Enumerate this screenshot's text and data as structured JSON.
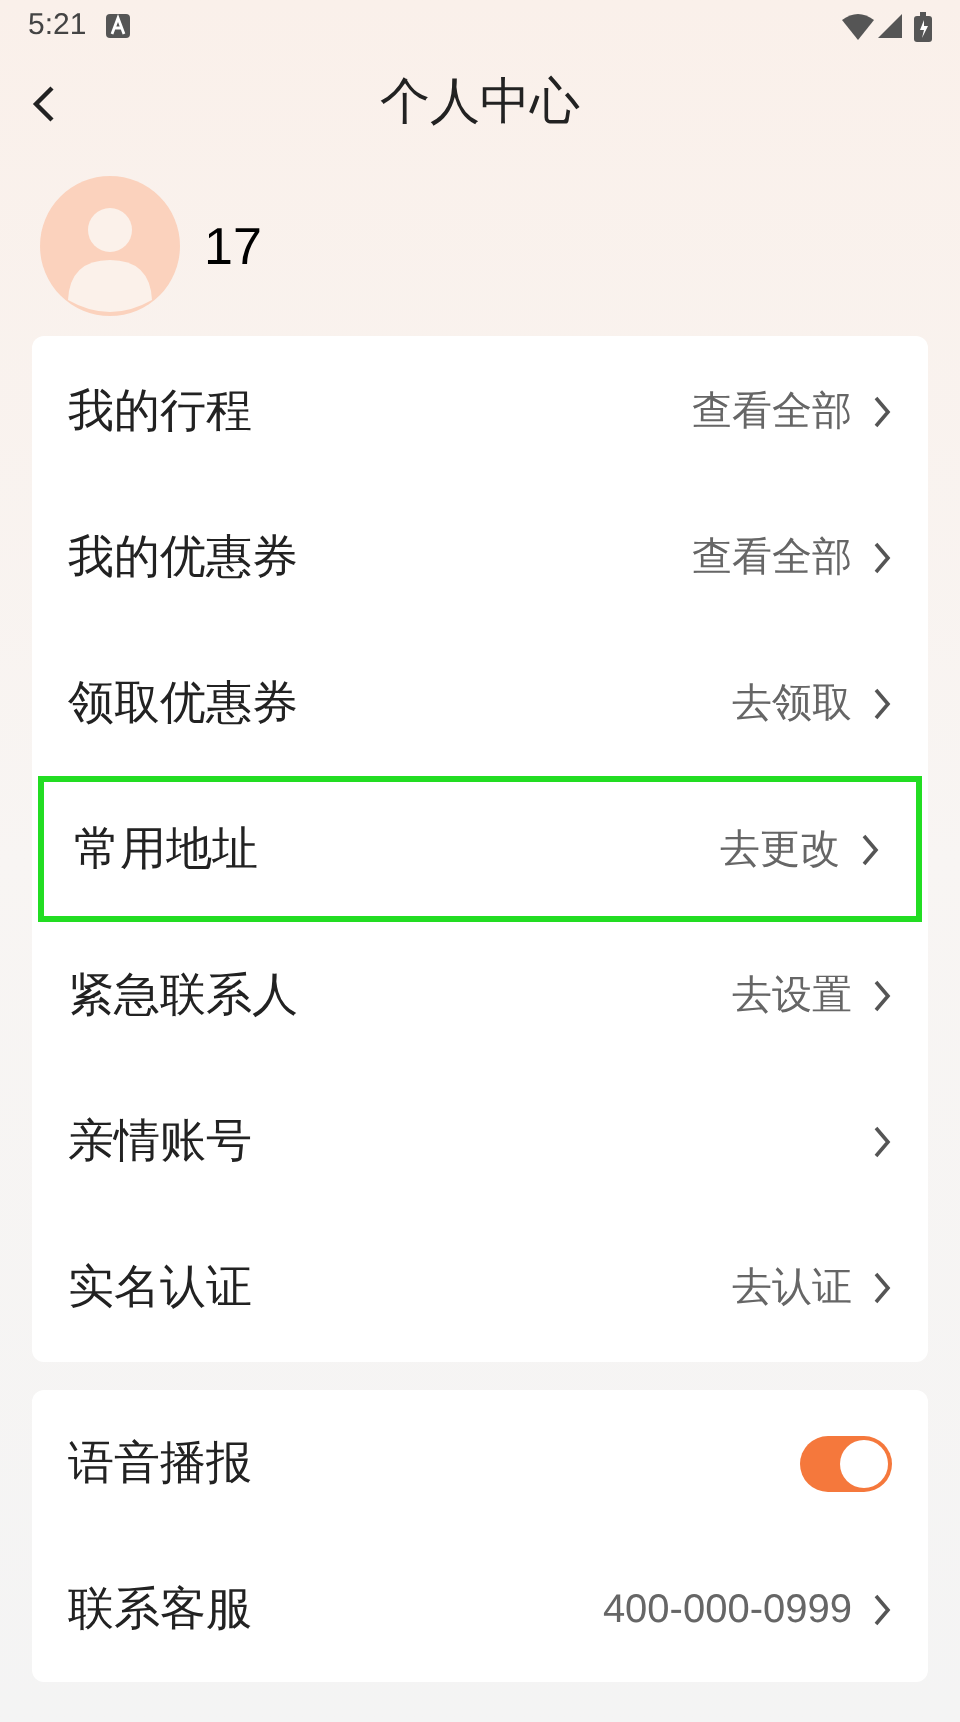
{
  "status_bar": {
    "time": "5:21"
  },
  "header": {
    "title": "个人中心"
  },
  "profile": {
    "name": "17"
  },
  "menu": [
    {
      "label": "我的行程",
      "action": "查看全部",
      "highlighted": false
    },
    {
      "label": "我的优惠券",
      "action": "查看全部",
      "highlighted": false
    },
    {
      "label": "领取优惠券",
      "action": "去领取",
      "highlighted": false
    },
    {
      "label": "常用地址",
      "action": "去更改",
      "highlighted": true
    },
    {
      "label": "紧急联系人",
      "action": "去设置",
      "highlighted": false
    },
    {
      "label": "亲情账号",
      "highlighted": false
    },
    {
      "label": "实名认证",
      "action": "去认证",
      "highlighted": false
    }
  ],
  "settings": [
    {
      "kind": "toggle",
      "label": "语音播报",
      "on": true
    },
    {
      "kind": "link",
      "label": "联系客服",
      "action": "400-000-0999"
    }
  ]
}
